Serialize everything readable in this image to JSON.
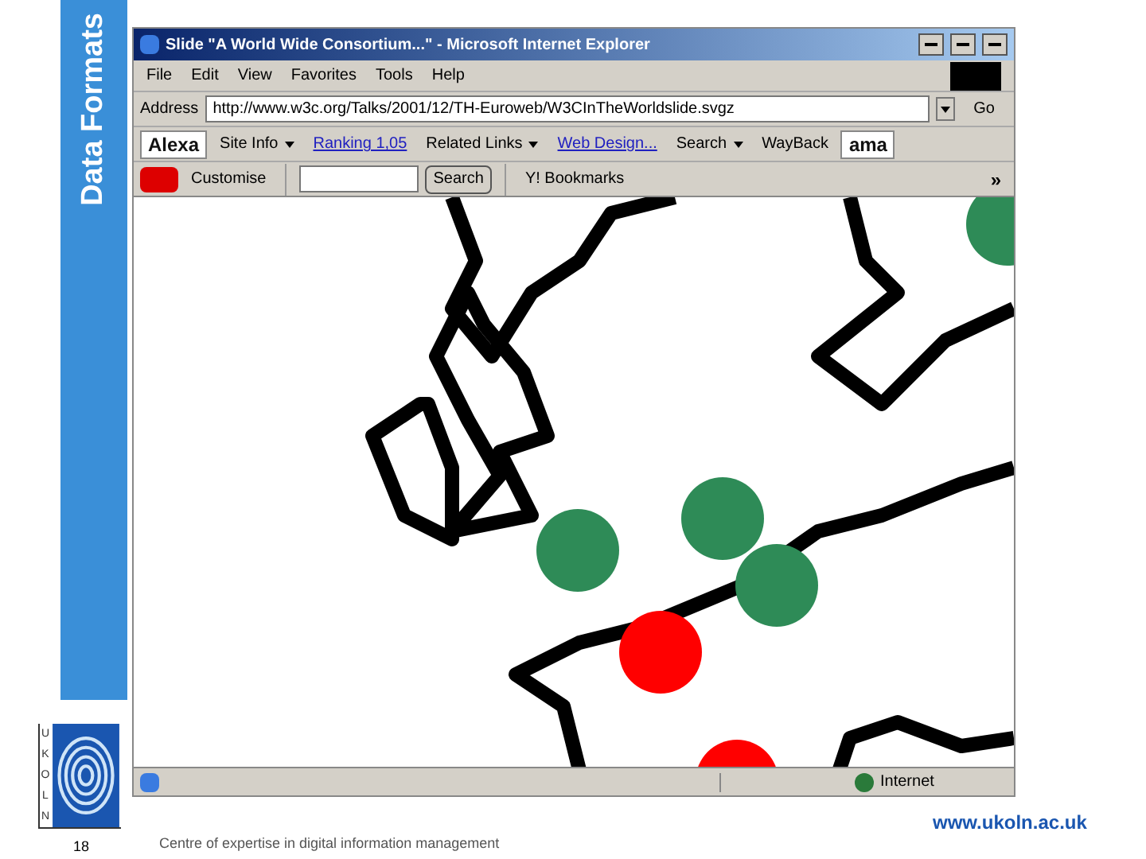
{
  "slide": {
    "section_title": "Data Formats",
    "logo_text": "UKOLN",
    "page_number": "18",
    "footer_left": "Centre of expertise in digital information management",
    "footer_right": "www.ukoln.ac.uk"
  },
  "window": {
    "title": "Slide \"A World Wide Consortium...\" - Microsoft Internet Explorer"
  },
  "menu": [
    "File",
    "Edit",
    "View",
    "Favorites",
    "Tools",
    "Help"
  ],
  "address": {
    "label": "Address",
    "value": "http://www.w3c.org/Talks/2001/12/TH-Euroweb/W3CInTheWorldslide.svgz",
    "go": "Go"
  },
  "alexa_bar": [
    {
      "kind": "logo",
      "label": "Alexa"
    },
    {
      "kind": "menu",
      "label": "Site Info"
    },
    {
      "kind": "link",
      "label": "Ranking 1,05"
    },
    {
      "kind": "menu",
      "label": "Related Links"
    },
    {
      "kind": "link",
      "label": "Web Design..."
    },
    {
      "kind": "menu",
      "label": "Search"
    },
    {
      "kind": "button",
      "label": "WayBack"
    },
    {
      "kind": "logo",
      "label": "ama"
    }
  ],
  "yahoo_bar": {
    "customise": "Customise",
    "search_button": "Search",
    "bookmarks": "Y! Bookmarks",
    "more": "»"
  },
  "status_bar": {
    "zone": "Internet"
  }
}
